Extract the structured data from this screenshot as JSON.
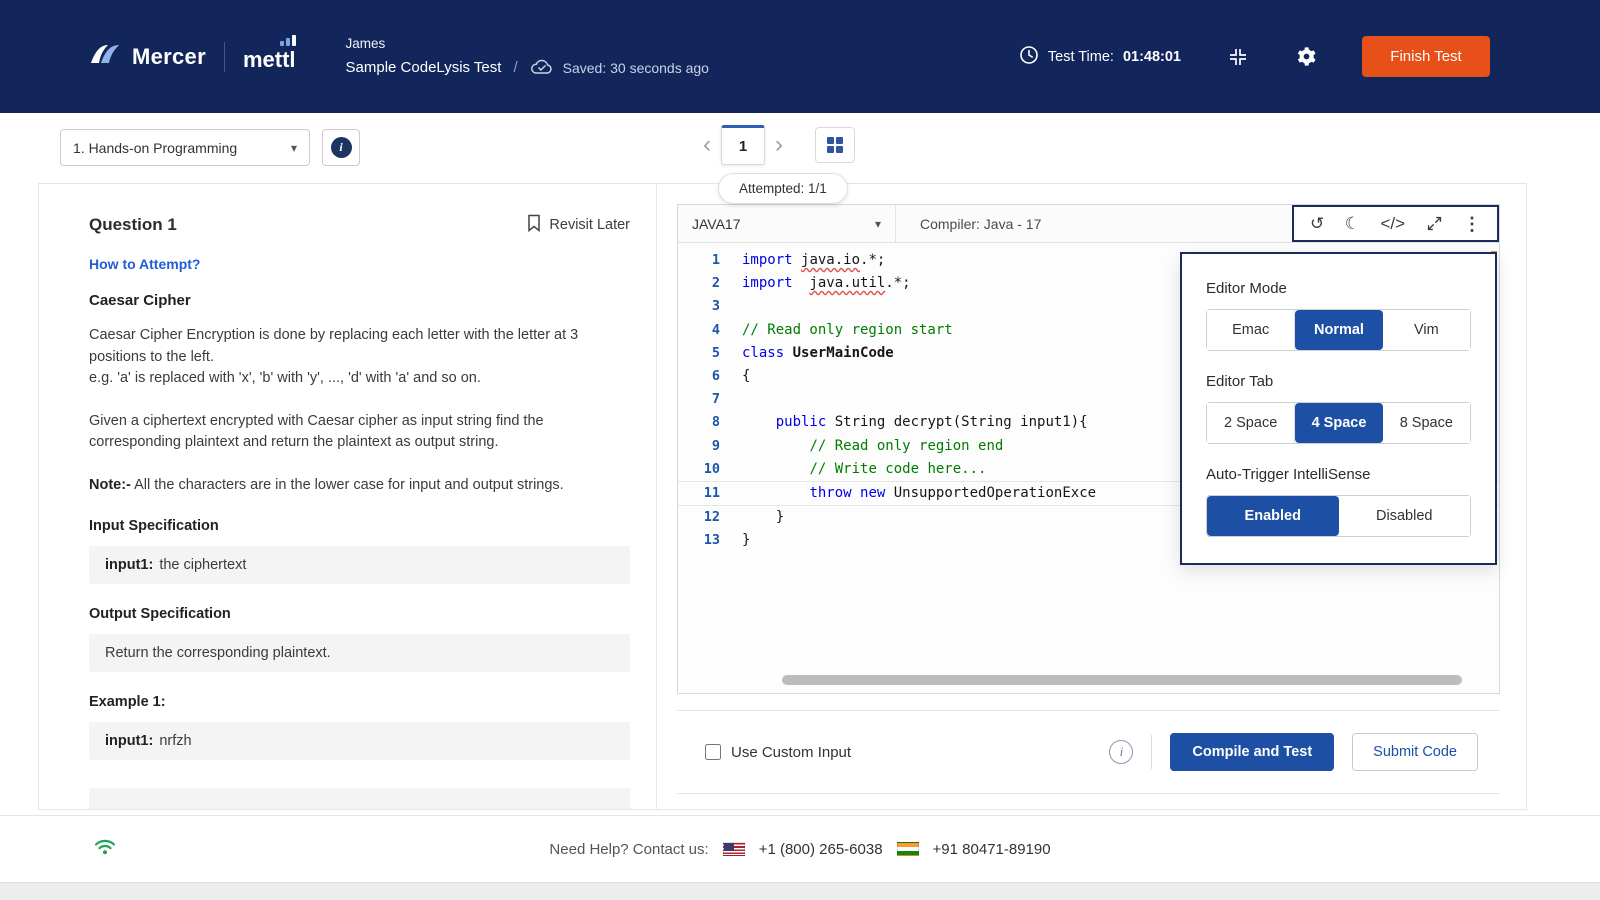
{
  "icons": {
    "chevron_down": "▾",
    "chevron_left": "‹",
    "chevron_right": "›",
    "history": "↺",
    "moon": "☾",
    "code": "</>",
    "kebab": "⋮",
    "info": "i"
  },
  "colors": {
    "header_navy": "#13265c",
    "accent_blue": "#1d4fa5",
    "finish_orange": "#e8501a",
    "comment_green": "#007d00",
    "keyword_blue": "#0000e6"
  },
  "header": {
    "brand": {
      "mercer": "Mercer",
      "mettl": "mettl"
    },
    "user_name": "James",
    "test_name": "Sample CodeLysis Test",
    "separator": "/",
    "saved_status": "Saved: 30 seconds ago",
    "test_time_label": "Test Time:",
    "test_time_value": "01:48:01",
    "finish_button": "Finish Test"
  },
  "toolbar": {
    "section_dropdown": "1. Hands-on Programming",
    "page_number": "1",
    "attempted_badge": "Attempted: 1/1"
  },
  "question": {
    "title": "Question 1",
    "revisit_later": "Revisit Later",
    "how_to_attempt": "How to Attempt?",
    "heading": "Caesar Cipher",
    "para1_line1": "Caesar Cipher Encryption is done by replacing each letter with the letter at 3 positions to the left.",
    "para1_line2": "e.g. 'a' is replaced with 'x', 'b' with 'y', ..., 'd' with 'a' and so on.",
    "para2": "Given a ciphertext encrypted with Caesar cipher as input string find the corresponding plaintext and return the plaintext as output string.",
    "note_label": "Note:-",
    "note_text": "All the characters are in the lower case for input and output strings.",
    "input_spec_label": "Input Specification",
    "input_spec_key": "input1:",
    "input_spec_value": "the ciphertext",
    "output_spec_label": "Output Specification",
    "output_spec_value": "Return the corresponding plaintext.",
    "example_label": "Example 1:",
    "example_input_key": "input1:",
    "example_input_value": "nrfzh"
  },
  "editor": {
    "language": "JAVA17",
    "compiler": "Compiler: Java - 17",
    "code_lines": [
      {
        "n": 1,
        "tokens": [
          [
            "import",
            "kw"
          ],
          [
            " ",
            ""
          ],
          [
            "java.io",
            "err"
          ],
          [
            ".*;",
            ""
          ]
        ]
      },
      {
        "n": 2,
        "tokens": [
          [
            "import",
            "kw"
          ],
          [
            "  ",
            ""
          ],
          [
            "java.util",
            "err"
          ],
          [
            ".*;",
            ""
          ]
        ]
      },
      {
        "n": 3,
        "tokens": []
      },
      {
        "n": 4,
        "tokens": [
          [
            "// Read only region start",
            "cm"
          ]
        ]
      },
      {
        "n": 5,
        "tokens": [
          [
            "class",
            "kw"
          ],
          [
            " ",
            ""
          ],
          [
            "UserMainCode",
            "cls"
          ]
        ]
      },
      {
        "n": 6,
        "tokens": [
          [
            "{",
            ""
          ]
        ]
      },
      {
        "n": 7,
        "tokens": []
      },
      {
        "n": 8,
        "tokens": [
          [
            "    ",
            ""
          ],
          [
            "public",
            "kw"
          ],
          [
            " String decrypt(String input1){",
            ""
          ]
        ]
      },
      {
        "n": 9,
        "tokens": [
          [
            "        ",
            ""
          ],
          [
            "// Read only region end",
            "cm"
          ]
        ]
      },
      {
        "n": 10,
        "tokens": [
          [
            "        ",
            ""
          ],
          [
            "// Write code here...",
            "cm"
          ]
        ]
      },
      {
        "n": 11,
        "active": true,
        "tokens": [
          [
            "        ",
            ""
          ],
          [
            "throw",
            "kw"
          ],
          [
            " ",
            ""
          ],
          [
            "new",
            "kw"
          ],
          [
            " UnsupportedOperationExce",
            ""
          ]
        ]
      },
      {
        "n": 12,
        "tokens": [
          [
            "    }",
            ""
          ]
        ]
      },
      {
        "n": 13,
        "tokens": [
          [
            "}",
            ""
          ]
        ]
      }
    ],
    "use_custom_input": "Use Custom Input",
    "compile_button": "Compile and Test",
    "submit_button": "Submit Code"
  },
  "settings_popup": {
    "editor_mode_label": "Editor Mode",
    "editor_mode_options": [
      "Emac",
      "Normal",
      "Vim"
    ],
    "editor_mode_selected": "Normal",
    "editor_tab_label": "Editor Tab",
    "editor_tab_options": [
      "2 Space",
      "4 Space",
      "8 Space"
    ],
    "editor_tab_selected": "4 Space",
    "intellisense_label": "Auto-Trigger IntelliSense",
    "intellisense_options": [
      "Enabled",
      "Disabled"
    ],
    "intellisense_selected": "Enabled"
  },
  "footer": {
    "help_text": "Need Help? Contact us:",
    "phone_us": "+1 (800) 265-6038",
    "phone_in": "+91 80471-89190"
  }
}
